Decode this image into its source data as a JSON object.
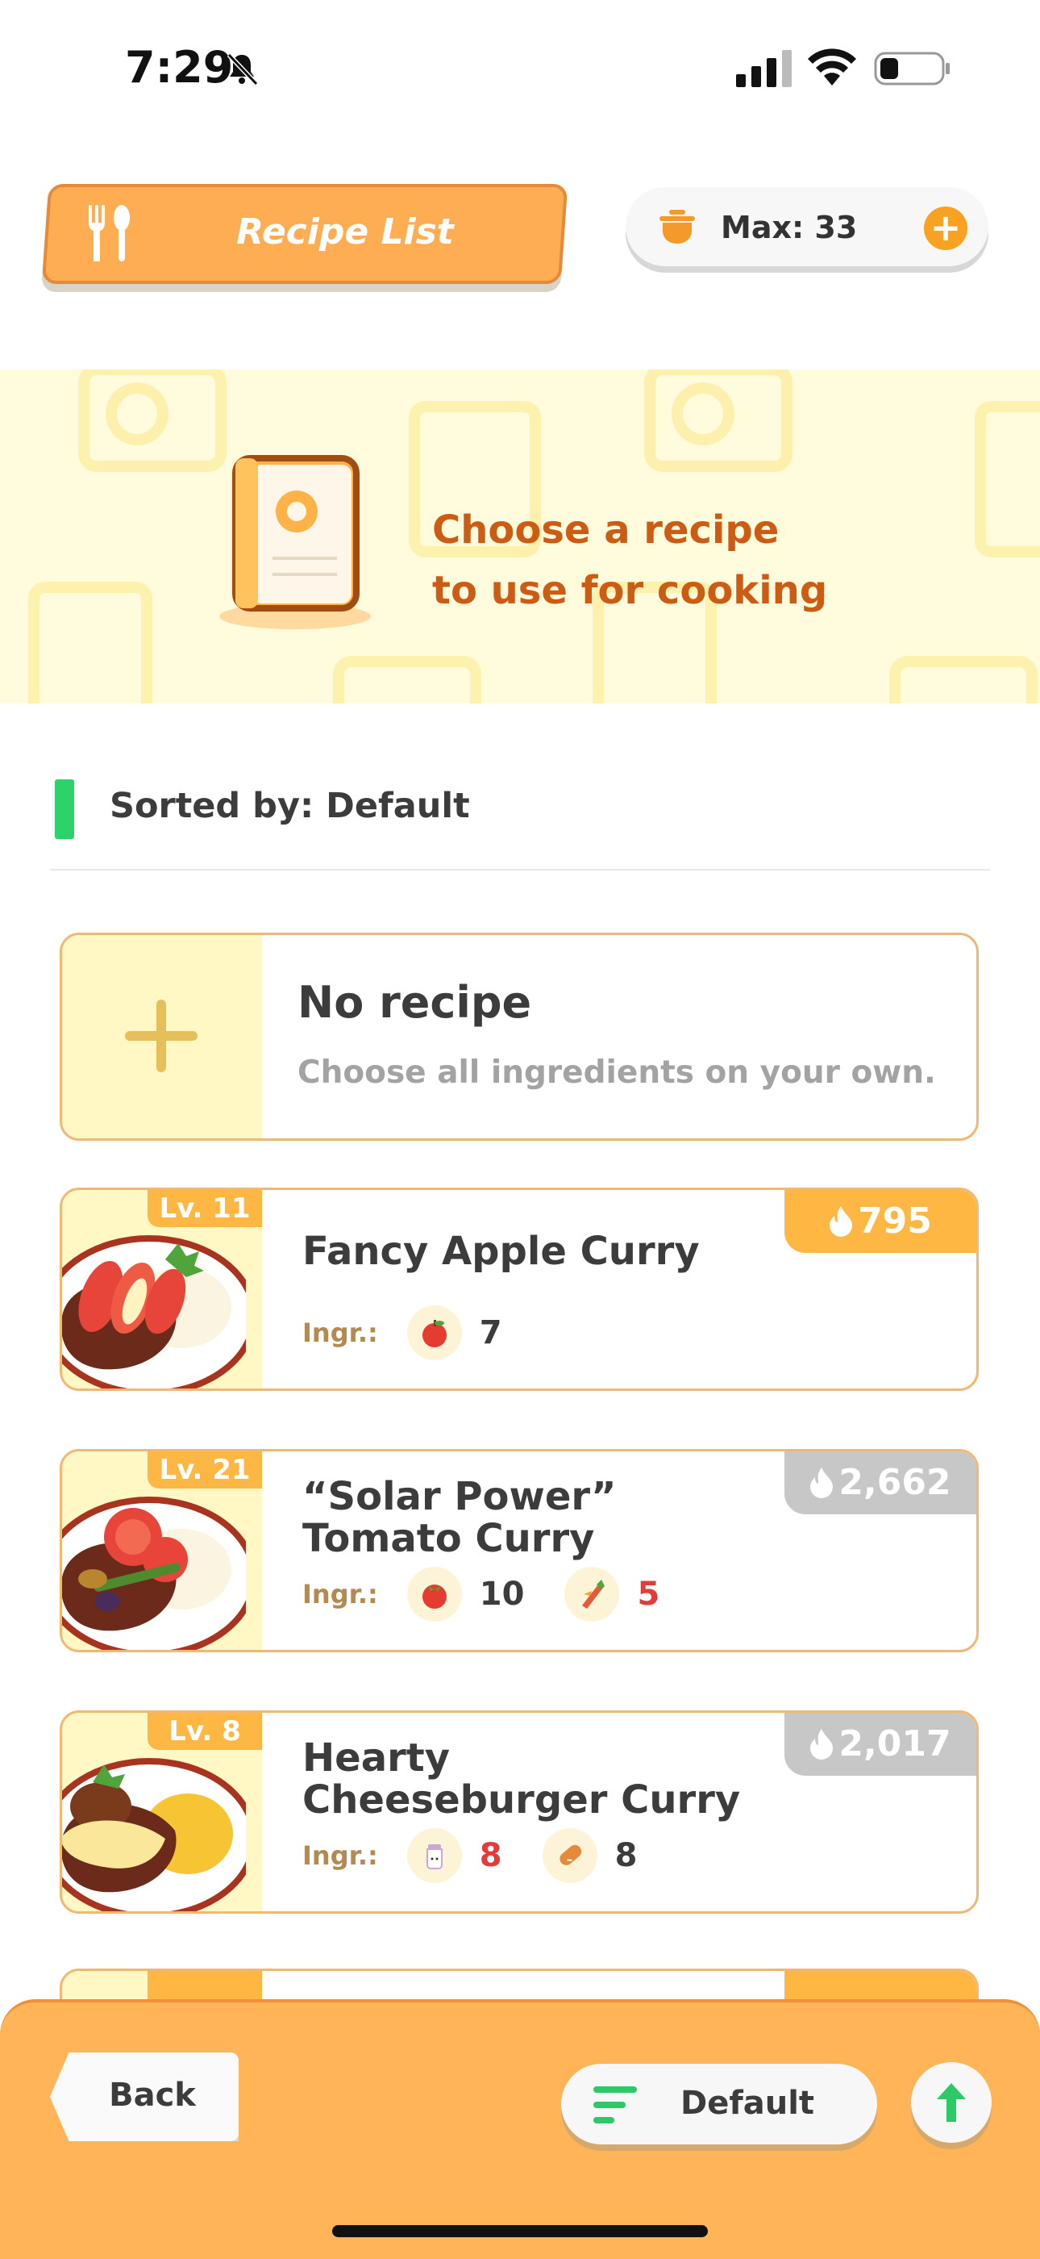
{
  "status_bar": {
    "time": "7:29"
  },
  "header": {
    "tab_title": "Recipe List",
    "max_label": "Max: 33"
  },
  "banner": {
    "line1": "Choose a recipe",
    "line2": "to use for cooking"
  },
  "sort": {
    "label": "Sorted by: Default"
  },
  "no_recipe": {
    "title": "No recipe",
    "subtitle": "Choose all ingredients on your own."
  },
  "recipes": [
    {
      "level": "Lv. 11",
      "name": "Fancy Apple Curry",
      "energy": "795",
      "ingr_label": "Ingr.:",
      "ingredients": [
        {
          "icon": "apple-icon",
          "count": "7",
          "shortage": false
        }
      ]
    },
    {
      "level": "Lv. 21",
      "name": "“Solar Power” Tomato Curry",
      "energy": "2,662",
      "ingr_label": "Ingr.:",
      "ingredients": [
        {
          "icon": "tomato-icon",
          "count": "10",
          "shortage": false
        },
        {
          "icon": "leek-icon",
          "count": "5",
          "shortage": true
        }
      ]
    },
    {
      "level": "Lv. 8",
      "name": "Hearty Cheeseburger Curry",
      "energy": "2,017",
      "ingr_label": "Ingr.:",
      "ingredients": [
        {
          "icon": "milk-icon",
          "count": "8",
          "shortage": true
        },
        {
          "icon": "sausage-icon",
          "count": "8",
          "shortage": false
        }
      ]
    }
  ],
  "bottom_bar": {
    "back_label": "Back",
    "sort_label": "Default"
  },
  "colors": {
    "accent": "#ffb457",
    "energy_gold": "#ffb743",
    "energy_grey": "#c7c7c7",
    "shortage_red": "#e43a3a"
  }
}
